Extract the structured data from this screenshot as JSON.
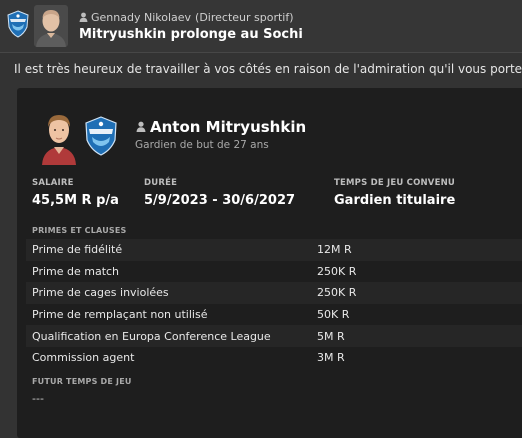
{
  "header": {
    "sender_name": "Gennady Nikolaev",
    "sender_role": "(Directeur sportif)",
    "title": "Mitryushkin prolonge au Sochi",
    "club_logo_icon": "sochi-club-logo",
    "avatar_icon": "person-avatar"
  },
  "message": {
    "text": "Il est très heureux de travailler à vos côtés en raison de l'admiration qu'il vous porte."
  },
  "player": {
    "name": "Anton Mitryushkin",
    "description": "Gardien de but de 27 ans",
    "photo_icon": "player-photo",
    "badge_icon": "sochi-club-badge"
  },
  "contract": {
    "salary_label": "SALAIRE",
    "salary_value": "45,5M R p/a",
    "duration_label": "DURÉE",
    "duration_value": "5/9/2023 - 30/6/2027",
    "playtime_label": "TEMPS DE JEU CONVENU",
    "playtime_value": "Gardien titulaire"
  },
  "bonuses": {
    "label": "PRIMES ET CLAUSES",
    "rows": [
      {
        "name": "Prime de fidélité",
        "value": "12M R"
      },
      {
        "name": "Prime de match",
        "value": "250K R"
      },
      {
        "name": "Prime de cages inviolées",
        "value": "250K R"
      },
      {
        "name": "Prime de remplaçant non utilisé",
        "value": "50K R"
      },
      {
        "name": "Qualification en Europa Conference League",
        "value": "5M R"
      },
      {
        "name": "Commission agent",
        "value": "3M R"
      }
    ]
  },
  "future": {
    "label": "FUTUR TEMPS DE JEU",
    "value": "---"
  },
  "colors": {
    "background": "#333333",
    "card": "#1e1e1e",
    "row_alt": "#262626",
    "badge_blue": "#1f6fb5"
  }
}
